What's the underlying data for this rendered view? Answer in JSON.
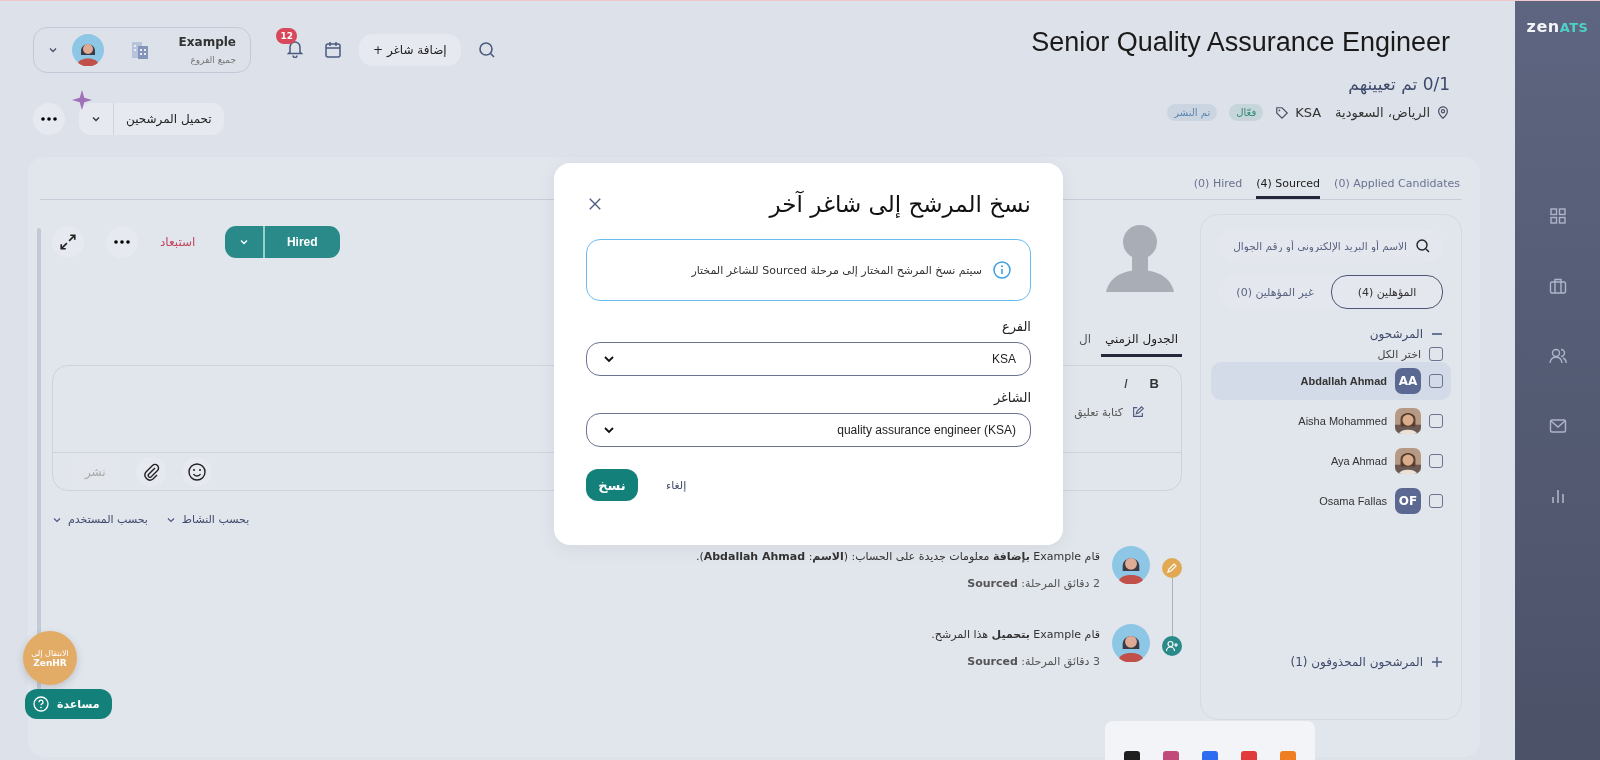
{
  "header": {
    "title": "Senior Quality Assurance Engineer",
    "hired_count": "0/1 تم تعيينهم",
    "location": "الرياض، السعودية",
    "branch_tag": "KSA",
    "badges": [
      {
        "label": "فعّال",
        "color": "#2e8a6e"
      },
      {
        "label": "تم النشر",
        "color": "#5b86b0"
      }
    ]
  },
  "user": {
    "name": "Example",
    "branch": "جميع الفروع"
  },
  "notifications": {
    "count": "12"
  },
  "add_job": {
    "icon": "+",
    "label": "إضافة شاغر"
  },
  "upload_button": "تحميل المرشحين",
  "tabs": [
    {
      "label": "(0) Applied Candidates",
      "selected": false
    },
    {
      "label": "(4) Sourced",
      "selected": true
    },
    {
      "label": "(0) Hired",
      "selected": false
    }
  ],
  "candidate": {
    "stage_button": "Hired",
    "reject": "استبعاد",
    "tabs": [
      {
        "label": "الجدول الزمني",
        "selected": true
      },
      {
        "label": "ال",
        "selected": false
      }
    ],
    "comment": {
      "bold": "B",
      "italic": "I",
      "placeholder": "كتابة تعليق",
      "post": "نشر"
    },
    "filters": [
      "بحسب النشاط",
      "بحسب المستخدم"
    ],
    "timeline": [
      {
        "kind": "edit",
        "text": "قام Example **بإضافة** معلومات جديدة على الحساب: (**الاسم**: **Abdallah Ahmad**).",
        "meta": "2 دقائق المرحلة: **Sourced**"
      },
      {
        "kind": "added",
        "text": "قام Example **بتحميل** هذا المرشح.",
        "meta": "3 دقائق المرحلة: **Sourced**"
      }
    ]
  },
  "list": {
    "search_placeholder": "الاسم أو البريد الإلكتروني أو رقم الجوال",
    "segments": [
      {
        "label": "المؤهلين (4)",
        "selected": true
      },
      {
        "label": "غير المؤهلين (0)",
        "selected": false
      }
    ],
    "group": {
      "label": "المرشحون",
      "expanded": true
    },
    "select_all": {
      "label": "اختر الكل",
      "checked": false
    },
    "candidates": [
      {
        "kind": "initials",
        "name": "Abdallah Ahmad",
        "initials": "AA",
        "selected": true,
        "checked": false
      },
      {
        "name": "Aisha Mohammed",
        "selected": false,
        "checked": false
      },
      {
        "name": "Aya Ahmad",
        "selected": false,
        "checked": false
      },
      {
        "kind": "initials",
        "name": "Osama Fallas",
        "initials": "OF",
        "selected": false,
        "checked": false
      }
    ],
    "deleted": "المرشحون المحذوفون (1)"
  },
  "modal": {
    "title": "نسخ المرشح إلى شاغر آخر",
    "info": "سيتم نسخ المرشح المختار إلى مرحلة Sourced للشاغر المختار",
    "fields": [
      {
        "label": "الفرع",
        "value": "KSA"
      },
      {
        "label": "الشاغر",
        "value": "quality assurance engineer (KSA)"
      }
    ],
    "confirm": "نسخ",
    "cancel": "إلغاء"
  },
  "floating": {
    "zenhr_line1": "الانتقال إلى",
    "zenhr_line2": "ZenHR",
    "help": "مساعدة"
  },
  "logo": {
    "main": "zen",
    "accent": "ATS"
  },
  "nav": [
    {
      "kind": "grid"
    },
    {
      "kind": "briefcase"
    },
    {
      "kind": "users"
    },
    {
      "kind": "mail"
    },
    {
      "kind": "chart"
    }
  ],
  "taskbar": [
    {
      "color": "#1f1f1f"
    },
    {
      "color": "#c24a7a"
    },
    {
      "color": "#2d6cf0"
    },
    {
      "color": "#e03a3a"
    },
    {
      "color": "#ef7d22"
    }
  ]
}
